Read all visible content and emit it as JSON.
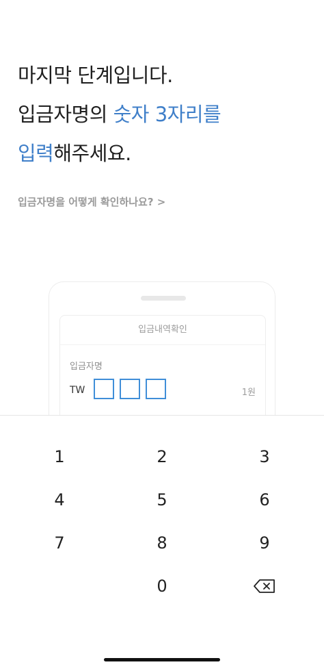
{
  "instruction": {
    "line1": "마지막 단계입니다.",
    "line2_plain": "입금자명의 ",
    "line2_accent": "숫자 3자리를",
    "line3_accent": "입력",
    "line3_plain": "해주세요."
  },
  "help_link": "입금자명을 어떻게 확인하나요? >",
  "illustration": {
    "card_title": "입금내역확인",
    "depositor_label": "입금자명",
    "prefix": "TW",
    "amount": "1원"
  },
  "keypad": {
    "keys": [
      "1",
      "2",
      "3",
      "4",
      "5",
      "6",
      "7",
      "8",
      "9",
      "0"
    ],
    "backspace_icon": "backspace-icon"
  },
  "colors": {
    "accent": "#3f7fc9",
    "digit_box_border": "#3f8ed8",
    "text_primary": "#1f1f1f",
    "text_muted": "#9a9a9a"
  }
}
